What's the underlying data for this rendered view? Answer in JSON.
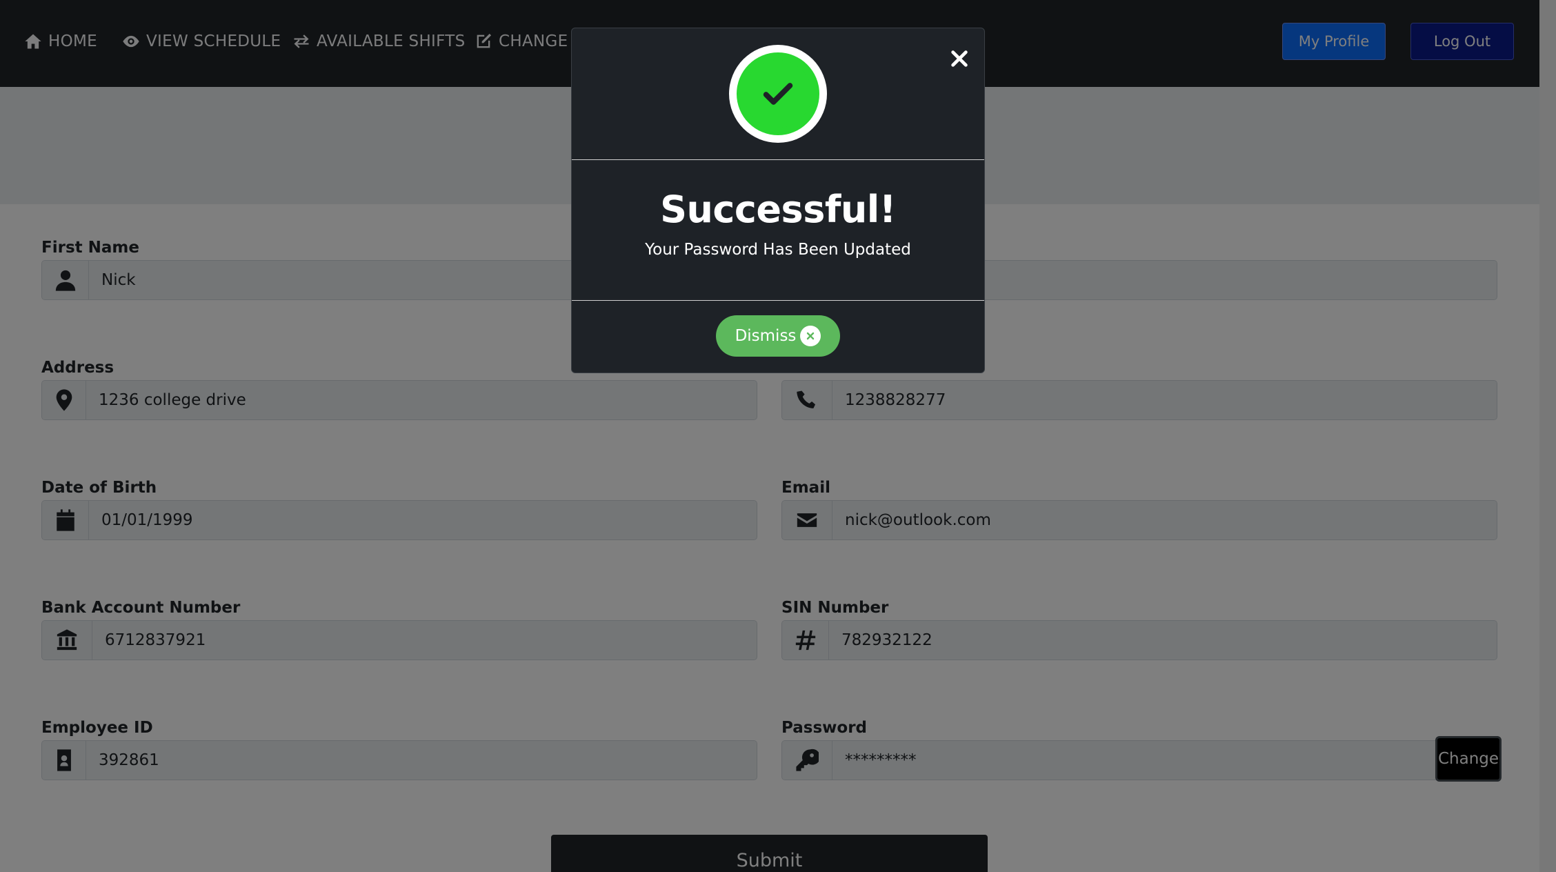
{
  "nav": {
    "home": "HOME",
    "view_schedule": "VIEW SCHEDULE",
    "available_shifts": "AVAILABLE SHIFTS",
    "change_availability": "CHANGE A",
    "my_profile": "My Profile",
    "log_out": "Log Out"
  },
  "form": {
    "first_name": {
      "label": "First Name",
      "value": "Nick",
      "icon": "user-icon"
    },
    "last_name": {
      "label": "",
      "value": "",
      "icon": ""
    },
    "address": {
      "label": "Address",
      "value": "1236 college drive",
      "icon": "map-marker-icon"
    },
    "phone": {
      "label": "",
      "value": "1238828277",
      "icon": "phone-icon"
    },
    "dob": {
      "label": "Date of Birth",
      "value": "01/01/1999",
      "icon": "calendar-icon"
    },
    "email": {
      "label": "Email",
      "value": "nick@outlook.com",
      "icon": "envelope-icon"
    },
    "bank": {
      "label": "Bank Account Number",
      "value": "6712837921",
      "icon": "bank-icon"
    },
    "sin": {
      "label": "SIN Number",
      "value": "782932122",
      "icon": "hashtag-icon"
    },
    "employee_id": {
      "label": "Employee ID",
      "value": "392861",
      "icon": "id-badge-icon"
    },
    "password": {
      "label": "Password",
      "value": "*********",
      "icon": "key-icon",
      "change_label": "Change"
    },
    "submit_label": "Submit"
  },
  "modal": {
    "title": "Successful!",
    "message": "Your Password Has Been Updated",
    "dismiss_label": "Dismiss"
  },
  "colors": {
    "navbar": "#212529",
    "success_green": "#28d830",
    "dismiss_green": "#5cb85c",
    "primary_blue": "#0d6efd",
    "dark_blue": "#0b1a8a"
  }
}
